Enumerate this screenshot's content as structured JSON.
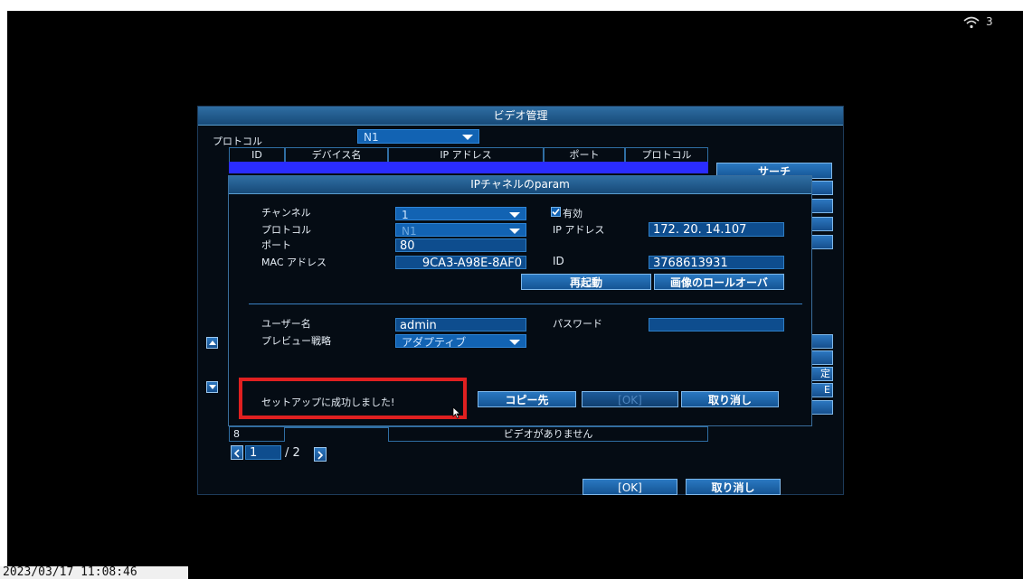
{
  "status": {
    "timestamp": "2023/03/17 11:08:46",
    "wifi_count": "3"
  },
  "video_mgmt": {
    "title": "ビデオ管理",
    "protocol_label": "プロトコル",
    "protocol_value": "N1",
    "columns": [
      "ID",
      "デバイス名",
      "IP アドレス",
      "ポート",
      "プロトコル"
    ],
    "search_button": "サーチ",
    "row8": {
      "id": "8",
      "status": "ビデオがありません"
    },
    "page_current": "1",
    "page_total": "/ 2",
    "ok_button": "[OK]",
    "cancel_button": "取り消し",
    "side_label_a": "定",
    "side_label_b": "E"
  },
  "ip_channel": {
    "title": "IPチャネルのparam",
    "channel_label": "チャンネル",
    "channel_value": "1",
    "enabled_label": "有効",
    "protocol_label": "プロトコル",
    "protocol_value": "N1",
    "ip_label": "IP アドレス",
    "ip_value": "172. 20. 14.107",
    "port_label": "ポート",
    "port_value": "80",
    "mac_label": "MAC アドレス",
    "mac_value": "9CA3-A98E-8AF0",
    "id_label": "ID",
    "id_value": "3768613931",
    "reboot_button": "再起動",
    "rollover_button": "画像のロールオーバ",
    "username_label": "ユーザー名",
    "username_value": "admin",
    "password_label": "パスワード",
    "password_value": "",
    "preview_label": "プレビュー戦略",
    "preview_value": "アダプティブ",
    "success_message": "セットアップに成功しました!",
    "copy_button": "コピー先",
    "ok_button": "[OK]",
    "cancel_button": "取り消し"
  },
  "colors": {
    "highlight_border": "#e02020",
    "selected_row": "#2a2cff",
    "accent": "#1263b3"
  }
}
